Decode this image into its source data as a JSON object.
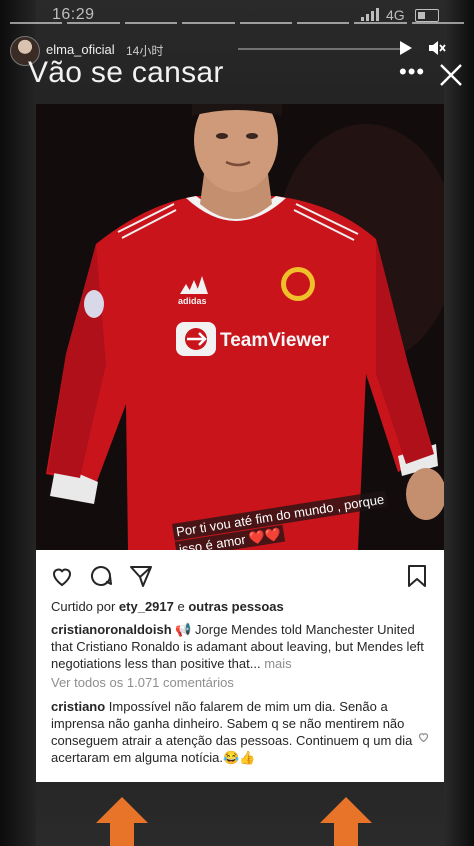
{
  "status_bar": {
    "time": "16:29",
    "network": "4G",
    "icons": [
      "signal-bars-icon",
      "battery-icon"
    ]
  },
  "story": {
    "username": "elma_oficial",
    "age": "14小时",
    "caption": "Vão se cansar",
    "more_glyph": "•••",
    "icons": [
      "play-icon",
      "mute-icon",
      "more-icon",
      "close-icon"
    ]
  },
  "sticker": {
    "text": "Por ti vou até fim do mundo , porque isso é amor ❤️❤️"
  },
  "post": {
    "likes_prefix": "Curtido por ",
    "likes_user": "ety_2917",
    "likes_connector": " e ",
    "likes_rest": "outras pessoas",
    "author": "cristianoronaldoish",
    "text": " 📢 Jorge Mendes told Manchester United that Cristiano Ronaldo is adamant about leaving, but Mendes left negotiations less than positive that...",
    "more": " mais",
    "view_all": "Ver todos os 1.071 comentários",
    "comment_author": "cristiano",
    "comment_text": " Impossível não falarem de mim um dia. Senão a imprensa não ganha dinheiro. Sabem q se não mentirem não conseguem atrair a atenção das pessoas. Continuem q um dia acertaram em alguma notícia.😂👍",
    "icons": [
      "like-icon",
      "comment-icon",
      "share-icon",
      "save-icon",
      "comment-like-icon"
    ]
  },
  "colors": {
    "arrow": "#e8742a",
    "jersey_red": "#c9141c",
    "card_bg": "#ffffff"
  }
}
